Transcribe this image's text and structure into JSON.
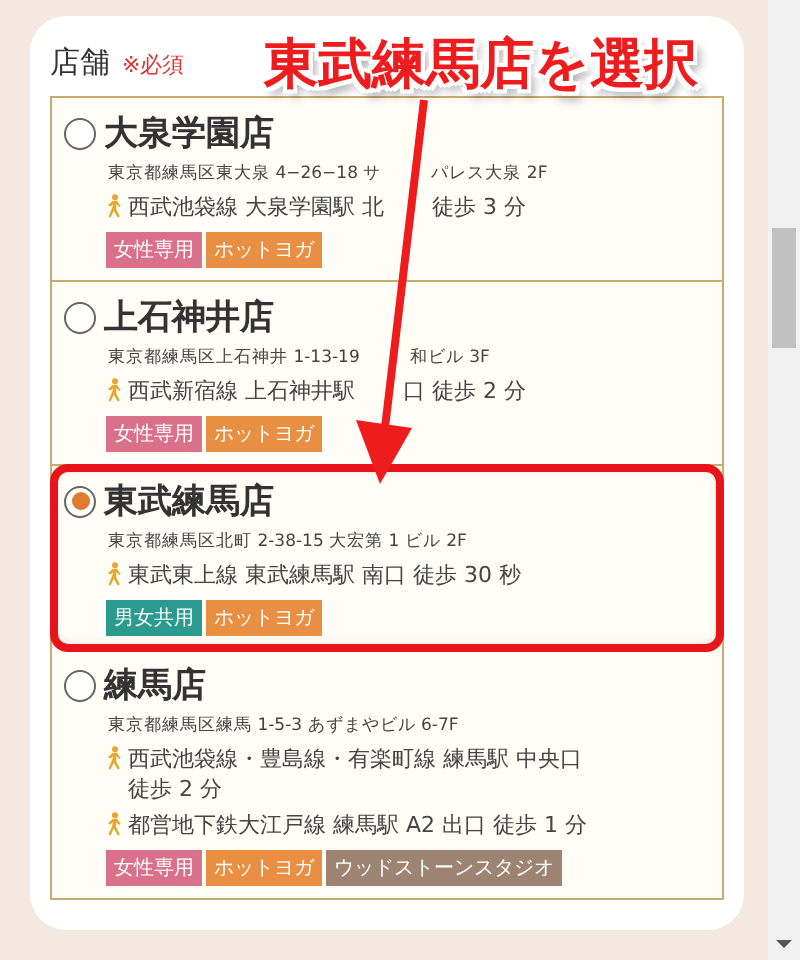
{
  "field": {
    "label": "店舗",
    "required": "※必須"
  },
  "annotation": {
    "text": "東武練馬店を選択"
  },
  "stores": [
    {
      "name": "大泉学園店",
      "selected": false,
      "address": [
        "東京都練馬区東大泉 4−26−18 サ",
        "パレス大泉 2F"
      ],
      "access": [
        {
          "kind": "gapped",
          "parts": [
            "西武池袋線 大泉学園駅 北",
            "徒歩 3 分"
          ]
        }
      ],
      "tags": [
        {
          "label": "女性専用",
          "color": "#d9718b"
        },
        {
          "label": "ホットヨガ",
          "color": "#e98f43"
        }
      ]
    },
    {
      "name": "上石神井店",
      "selected": false,
      "address": [
        "東京都練馬区上石神井 1-13-19",
        "和ビル 3F"
      ],
      "access": [
        {
          "kind": "gapped",
          "parts": [
            "西武新宿線 上石神井駅",
            "口 徒歩 2 分"
          ]
        }
      ],
      "tags": [
        {
          "label": "女性専用",
          "color": "#d9718b"
        },
        {
          "label": "ホットヨガ",
          "color": "#e98f43"
        }
      ]
    },
    {
      "name": "東武練馬店",
      "selected": true,
      "address": [
        "東京都練馬区北町 2-38-15 大宏第 1 ビル 2F"
      ],
      "access": [
        {
          "kind": "gapped",
          "parts": [
            "東武東上線 東武練馬駅 南口 徒歩 30 秒"
          ]
        }
      ],
      "tags": [
        {
          "label": "男女共用",
          "color": "#2b9b8f"
        },
        {
          "label": "ホットヨガ",
          "color": "#e98f43"
        }
      ]
    },
    {
      "name": "練馬店",
      "selected": false,
      "address": [
        "東京都練馬区練馬 1-5-3 あずまやビル 6-7F"
      ],
      "access": [
        {
          "kind": "wrapped",
          "parts": [
            "西武池袋線・豊島線・有楽町線 練馬駅 中央口",
            "徒歩 2 分"
          ]
        },
        {
          "kind": "gapped",
          "parts": [
            "都営地下鉄大江戸線 練馬駅 A2 出口 徒歩 1 分"
          ]
        }
      ],
      "tags": [
        {
          "label": "女性専用",
          "color": "#d9718b"
        },
        {
          "label": "ホットヨガ",
          "color": "#e98f43"
        },
        {
          "label": "ウッドストーンスタジオ",
          "color": "#9d8371"
        }
      ]
    }
  ]
}
